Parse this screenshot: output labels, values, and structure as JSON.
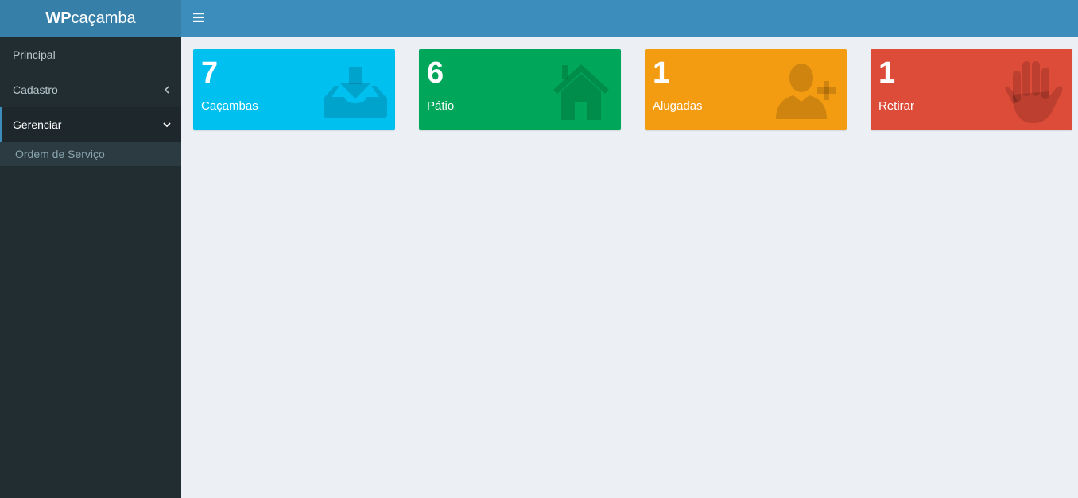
{
  "brand": {
    "bold": "WP",
    "light": "caçamba"
  },
  "header": {
    "toggle_icon": "bars-icon"
  },
  "sidebar": {
    "items": [
      {
        "label": "Principal"
      },
      {
        "label": "Cadastro",
        "chevron": "chevron-left-icon"
      },
      {
        "label": "Gerenciar",
        "chevron": "chevron-down-icon",
        "active": true
      }
    ],
    "submenu": [
      {
        "label": "Ordem de Serviço"
      }
    ]
  },
  "boxes": [
    {
      "number": "7",
      "label": "Caçambas",
      "color": "#00c0ef",
      "icon": "download-icon"
    },
    {
      "number": "6",
      "label": "Pátio",
      "color": "#00a65a",
      "icon": "home-icon"
    },
    {
      "number": "1",
      "label": "Alugadas",
      "color": "#f39c12",
      "icon": "user-plus-icon"
    },
    {
      "number": "1",
      "label": "Retirar",
      "color": "#dd4b39",
      "icon": "hand-stop-icon"
    }
  ]
}
